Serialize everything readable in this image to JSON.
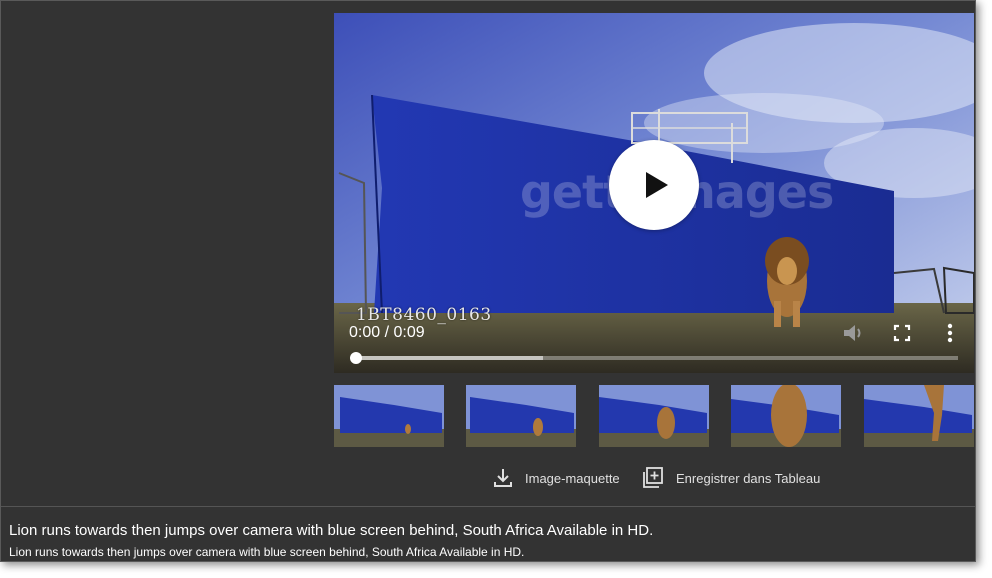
{
  "player": {
    "watermark": "gettyimages",
    "clip_id": "1BT8460_0163",
    "time_display": "0:00 / 0:09",
    "progress": 0.0,
    "buffered": 0.31
  },
  "thumbnails": [
    {
      "index": 1
    },
    {
      "index": 2
    },
    {
      "index": 3
    },
    {
      "index": 4
    },
    {
      "index": 5
    }
  ],
  "actions": {
    "download_label": "Image-maquette",
    "save_label": "Enregistrer dans Tableau"
  },
  "caption": {
    "title": "Lion runs towards then jumps over camera with blue screen behind, South Africa Available in HD.",
    "subtitle": "Lion runs towards then jumps over camera with blue screen behind, South Africa Available in HD."
  },
  "colors": {
    "panel_bg": "#333333",
    "sky": "#6f86cf",
    "screen_blue": "#1f35a8",
    "ground": "#4a4634",
    "lion": "#b07a3c"
  },
  "icons": {
    "play": "play-icon",
    "volume": "volume-icon",
    "fullscreen": "fullscreen-icon",
    "more": "more-vert-icon",
    "download": "download-icon",
    "add_board": "add-to-board-icon"
  }
}
